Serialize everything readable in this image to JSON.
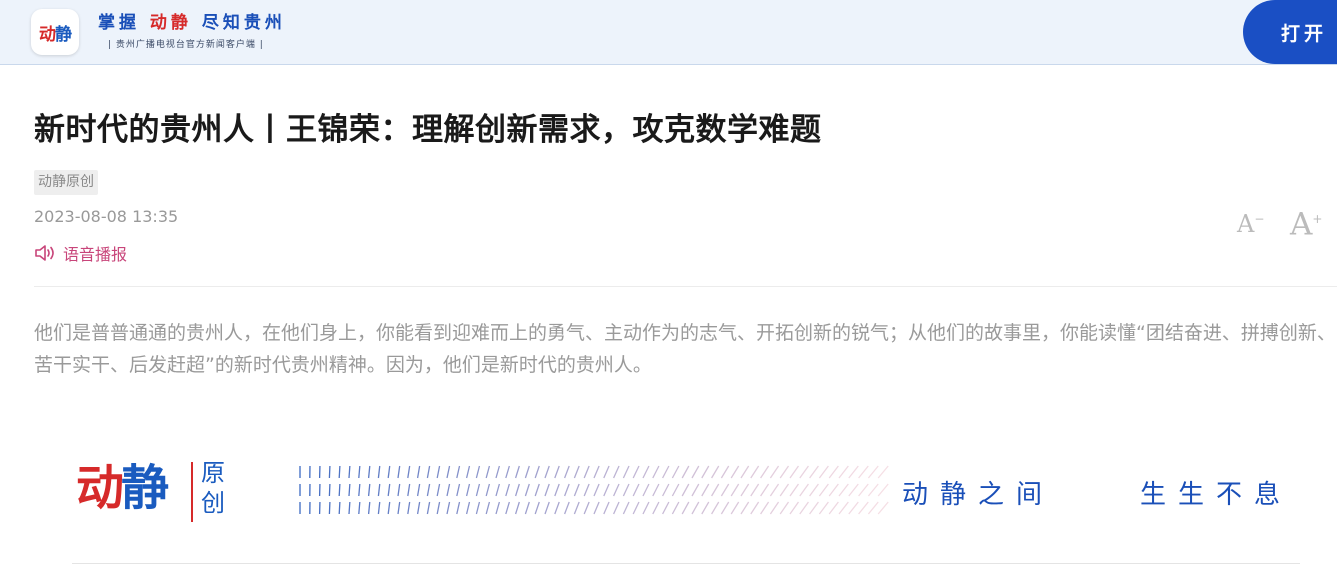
{
  "header": {
    "logo": {
      "part1": "动",
      "part2": "静"
    },
    "slogan": {
      "part1": "掌握",
      "part2": "动静",
      "part3": "尽知贵州"
    },
    "slogan_sub": "| 贵州广播电视台官方新闻客户端 |",
    "open_button": "打开"
  },
  "article": {
    "title": "新时代的贵州人丨王锦荣：理解创新需求，攻克数学难题",
    "tag": "动静原创",
    "date": "2023-08-08 13:35",
    "audio_label": "语音播报",
    "font_decrease": "A",
    "font_decrease_sign": "−",
    "font_increase": "A",
    "font_increase_sign": "+",
    "summary": "他们是普普通通的贵州人，在他们身上，你能看到迎难而上的勇气、主动作为的志气、开拓创新的锐气；从他们的故事里，你能读懂“团结奋进、拼搏创新、苦干实干、后发赶超”的新时代贵州精神。因为，他们是新时代的贵州人。"
  },
  "banner": {
    "logo_part1": "动",
    "logo_part2": "静",
    "yuan": "原",
    "chuang": "创",
    "slogan1": "动静之间",
    "slogan2": "生生不息"
  },
  "colors": {
    "brand_blue": "#1a4fc4",
    "brand_red": "#d62a2a",
    "audio_pink": "#c8457a"
  }
}
